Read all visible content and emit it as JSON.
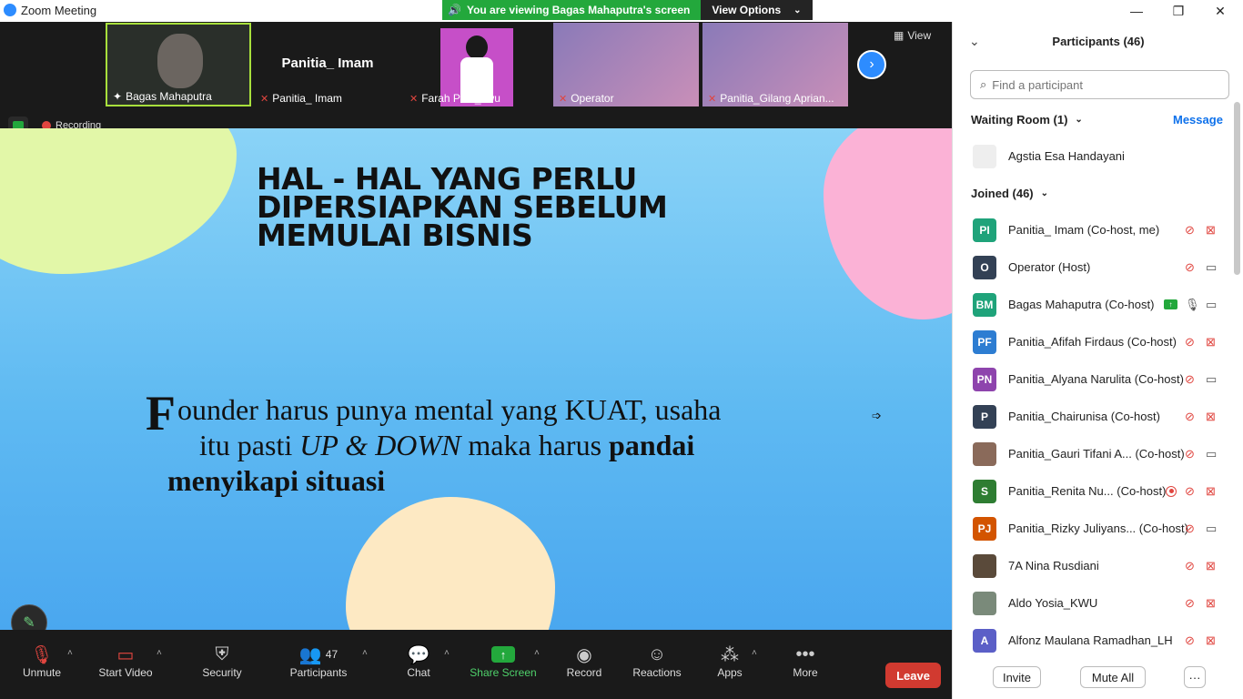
{
  "window": {
    "title": "Zoom Meeting",
    "minimize": "—",
    "maximize": "❐",
    "close": "✕"
  },
  "banner": {
    "viewing_text": "You are viewing Bagas Mahaputra's screen",
    "view_options": "View Options"
  },
  "thumbnails": [
    {
      "name": "Bagas Mahaputra",
      "status": "pinned"
    },
    {
      "name": "Panitia_ Imam",
      "display": "Panitia_ Imam",
      "status": "muted"
    },
    {
      "name": "Farah Paul_kwu",
      "status": "muted"
    },
    {
      "name": "Operator",
      "status": "muted"
    },
    {
      "name": "Panitia_Gilang Aprian...",
      "status": "muted"
    }
  ],
  "view_button": "View",
  "recording_label": "Recording",
  "slide": {
    "title": "HAL - HAL YANG PERLU DIPERSIAPKAN SEBELUM MEMULAI BISNIS",
    "body_dropcap": "F",
    "body_line1": "ounder harus punya mental yang KUAT, usaha",
    "body_line2_a": "itu pasti ",
    "body_line2_em": "UP & DOWN",
    "body_line2_b": " maka harus ",
    "body_line2_strong": "pandai",
    "body_line3": "menyikapi situasi"
  },
  "toolbar": {
    "unmute": "Unmute",
    "start_video": "Start Video",
    "security": "Security",
    "participants": "Participants",
    "participants_count": "47",
    "chat": "Chat",
    "share_screen": "Share Screen",
    "record": "Record",
    "reactions": "Reactions",
    "apps": "Apps",
    "more": "More",
    "leave": "Leave"
  },
  "panel": {
    "title": "Participants (46)",
    "search_placeholder": "Find a participant",
    "waiting_room_label": "Waiting Room (1)",
    "message_link": "Message",
    "waiting": [
      {
        "name": "Agstia Esa Handayani"
      }
    ],
    "joined_label": "Joined (46)",
    "joined": [
      {
        "initials": "PI",
        "name": "Panitia_ Imam (Co-host, me)",
        "color": "#1fa37a",
        "mic": "off",
        "cam": "off"
      },
      {
        "initials": "O",
        "name": "Operator (Host)",
        "color": "#334155",
        "mic": "off",
        "cam": "on"
      },
      {
        "initials": "BM",
        "name": "Bagas Mahaputra (Co-host)",
        "color": "#1fa37a",
        "mic": "on",
        "cam": "on",
        "sharing": true
      },
      {
        "initials": "PF",
        "name": "Panitia_Afifah Firdaus (Co-host)",
        "color": "#2d7dd2",
        "mic": "off",
        "cam": "off"
      },
      {
        "initials": "PN",
        "name": "Panitia_Alyana Narulita (Co-host)",
        "color": "#8e44ad",
        "mic": "off",
        "cam": "on"
      },
      {
        "initials": "P",
        "name": "Panitia_Chairunisa (Co-host)",
        "color": "#334155",
        "mic": "off",
        "cam": "off"
      },
      {
        "initials": "",
        "name": "Panitia_Gauri Tifani A...  (Co-host)",
        "color": "#8a6a5a",
        "mic": "off",
        "cam": "on"
      },
      {
        "initials": "S",
        "name": "Panitia_Renita Nu... (Co-host)",
        "color": "#2e7d32",
        "mic": "off",
        "cam": "off",
        "recording": true
      },
      {
        "initials": "PJ",
        "name": "Panitia_Rizky Juliyans...  (Co-host)",
        "color": "#d35400",
        "mic": "off",
        "cam": "on"
      },
      {
        "initials": "",
        "name": "7A Nina Rusdiani",
        "color": "#5a4a3a",
        "mic": "off",
        "cam": "off"
      },
      {
        "initials": "",
        "name": "Aldo Yosia_KWU",
        "color": "#7a8a7a",
        "mic": "off",
        "cam": "off"
      },
      {
        "initials": "A",
        "name": "Alfonz Maulana Ramadhan_LH",
        "color": "#5b5fc7",
        "mic": "off",
        "cam": "off"
      }
    ],
    "invite": "Invite",
    "mute_all": "Mute All",
    "more": "···"
  }
}
